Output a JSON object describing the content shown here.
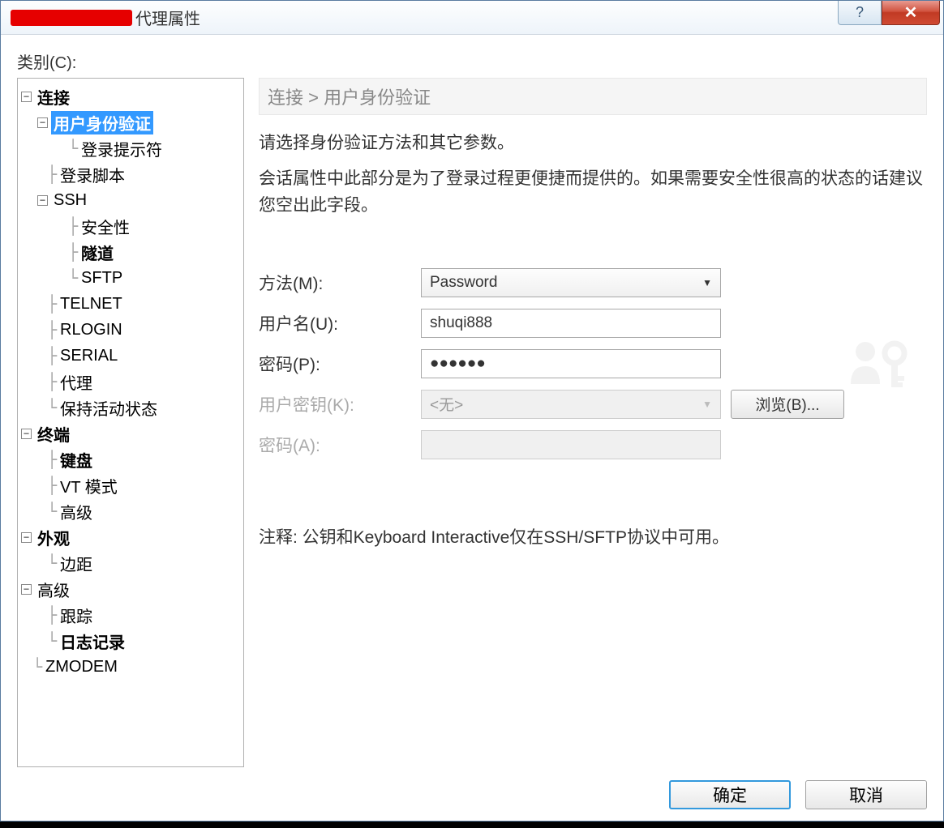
{
  "window": {
    "title_suffix": "代理属性"
  },
  "category_label": "类别(C):",
  "tree": {
    "connection": "连接",
    "user_auth": "用户身份验证",
    "login_prompt": "登录提示符",
    "login_script": "登录脚本",
    "ssh": "SSH",
    "security": "安全性",
    "tunnel": "隧道",
    "sftp": "SFTP",
    "telnet": "TELNET",
    "rlogin": "RLOGIN",
    "serial": "SERIAL",
    "proxy": "代理",
    "keepalive": "保持活动状态",
    "terminal": "终端",
    "keyboard": "键盘",
    "vtmode": "VT 模式",
    "advanced_term": "高级",
    "appearance": "外观",
    "margin": "边距",
    "advanced": "高级",
    "trace": "跟踪",
    "logging": "日志记录",
    "zmodem": "ZMODEM"
  },
  "breadcrumb": "连接 > 用户身份验证",
  "desc1": "请选择身份验证方法和其它参数。",
  "desc2": "会话属性中此部分是为了登录过程更便捷而提供的。如果需要安全性很高的状态的话建议您空出此字段。",
  "form": {
    "method_label": "方法(M):",
    "method_value": "Password",
    "username_label": "用户名(U):",
    "username_value": "shuqi888",
    "password_label": "密码(P):",
    "password_value": "●●●●●●",
    "userkey_label": "用户密钥(K):",
    "userkey_value": "<无>",
    "browse_label": "浏览(B)...",
    "passphrase_label": "密码(A):"
  },
  "note": "注释: 公钥和Keyboard Interactive仅在SSH/SFTP协议中可用。",
  "buttons": {
    "ok": "确定",
    "cancel": "取消"
  }
}
